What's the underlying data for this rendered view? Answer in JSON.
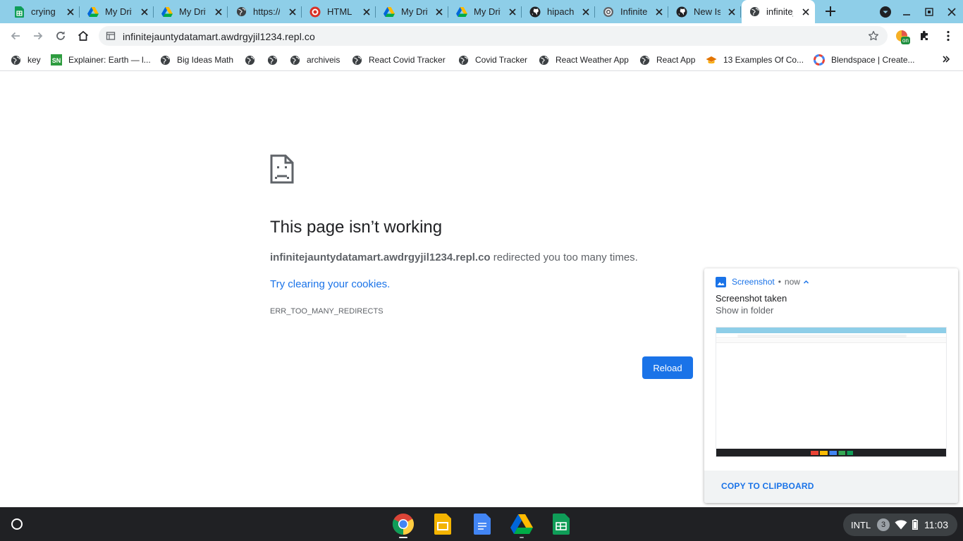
{
  "tabs": [
    {
      "title": "crying c",
      "icon": "google-sheets-icon"
    },
    {
      "title": "My Driv",
      "icon": "google-drive-icon"
    },
    {
      "title": "My Driv",
      "icon": "google-drive-icon"
    },
    {
      "title": "https://",
      "icon": "globe-icon"
    },
    {
      "title": "HTML C",
      "icon": "replit-icon"
    },
    {
      "title": "My Driv",
      "icon": "google-drive-icon"
    },
    {
      "title": "My Driv",
      "icon": "google-drive-icon"
    },
    {
      "title": "hipach",
      "icon": "github-icon"
    },
    {
      "title": "Infinite",
      "icon": "infinite-icon"
    },
    {
      "title": "New Iss",
      "icon": "github-icon"
    },
    {
      "title": "infinitej",
      "icon": "globe-icon",
      "active": true
    }
  ],
  "address_bar": {
    "url": "infinitejauntydatamart.awdrgyjil1234.repl.co"
  },
  "extension_badge": "on",
  "bookmarks": [
    {
      "label": "key",
      "icon": "globe-icon"
    },
    {
      "label": "Explainer: Earth — l...",
      "icon": "sn-icon"
    },
    {
      "label": "Big Ideas Math",
      "icon": "globe-icon"
    },
    {
      "label": "",
      "icon": "globe-icon"
    },
    {
      "label": "",
      "icon": "globe-icon"
    },
    {
      "label": "archiveis",
      "icon": "globe-icon"
    },
    {
      "label": "React Covid Tracker",
      "icon": "globe-icon"
    },
    {
      "label": "Covid Tracker",
      "icon": "globe-icon"
    },
    {
      "label": "React Weather App",
      "icon": "globe-icon"
    },
    {
      "label": "React App",
      "icon": "globe-icon"
    },
    {
      "label": "13 Examples Of Co...",
      "icon": "graduation-cap-icon"
    },
    {
      "label": "Blendspace | Create...",
      "icon": "blendspace-icon"
    }
  ],
  "error_page": {
    "title": "This page isn’t working",
    "host": "infinitejauntydatamart.awdrgyjil1234.repl.co",
    "detail_suffix": " redirected you too many times.",
    "link": "Try clearing your cookies",
    "link_suffix": ".",
    "error_code": "ERR_TOO_MANY_REDIRECTS",
    "reload_label": "Reload"
  },
  "notification": {
    "source": "Screenshot",
    "separator": "•",
    "time": "now",
    "title": "Screenshot taken",
    "message": "Show in folder",
    "action": "COPY TO CLIPBOARD"
  },
  "shelf": {
    "apps": [
      "chrome-icon",
      "google-slides-icon",
      "google-docs-icon",
      "google-drive-icon",
      "google-sheets-icon"
    ],
    "ime": "INTL",
    "notification_count": "3",
    "time": "11:03"
  },
  "colors": {
    "tabstrip": "#8ecee8",
    "accent": "#1a73e8",
    "shelf": "#202124"
  }
}
